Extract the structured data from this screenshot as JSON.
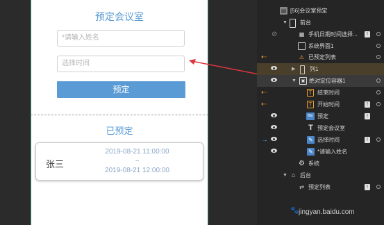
{
  "phone": {
    "title": "预定会议室",
    "name_placeholder": "*请输入姓名",
    "time_placeholder": "选择时间",
    "book_button": "预定",
    "booked_title": "已预定",
    "card": {
      "name": "张三",
      "start": "2019-08-21 11:00:00",
      "sep": "~",
      "end": "2019-08-21 12:00:00"
    }
  },
  "layers": [
    {
      "label": "[56]会议室预定",
      "icon": "page-icon"
    },
    {
      "label": "前台",
      "icon": "device-icon"
    },
    {
      "label": "手机日期时间选择...",
      "icon": "phone-icon"
    },
    {
      "label": "系统界面1",
      "icon": "screen-icon"
    },
    {
      "label": "已预定列表",
      "icon": "warning-icon"
    },
    {
      "label": "列1",
      "icon": "column-icon"
    },
    {
      "label": "绝对定位容器1",
      "icon": "container-icon"
    },
    {
      "label": "结束时间",
      "icon": "text-icon"
    },
    {
      "label": "开始时间",
      "icon": "text-icon"
    },
    {
      "label": "预定",
      "icon": "button-icon"
    },
    {
      "label": "预定会议室",
      "icon": "text-icon"
    },
    {
      "label": "选择时间",
      "icon": "edit-icon"
    },
    {
      "label": "*请输入姓名",
      "icon": "edit-icon"
    },
    {
      "label": "系统",
      "icon": "gear-icon"
    },
    {
      "label": "后台",
      "icon": "home-icon"
    },
    {
      "label": "预定列表",
      "icon": "list-icon"
    }
  ],
  "watermark": "jingyan.baidu.com",
  "colors": {
    "accent": "#5b9bd5",
    "arrow": "#d9363e"
  }
}
